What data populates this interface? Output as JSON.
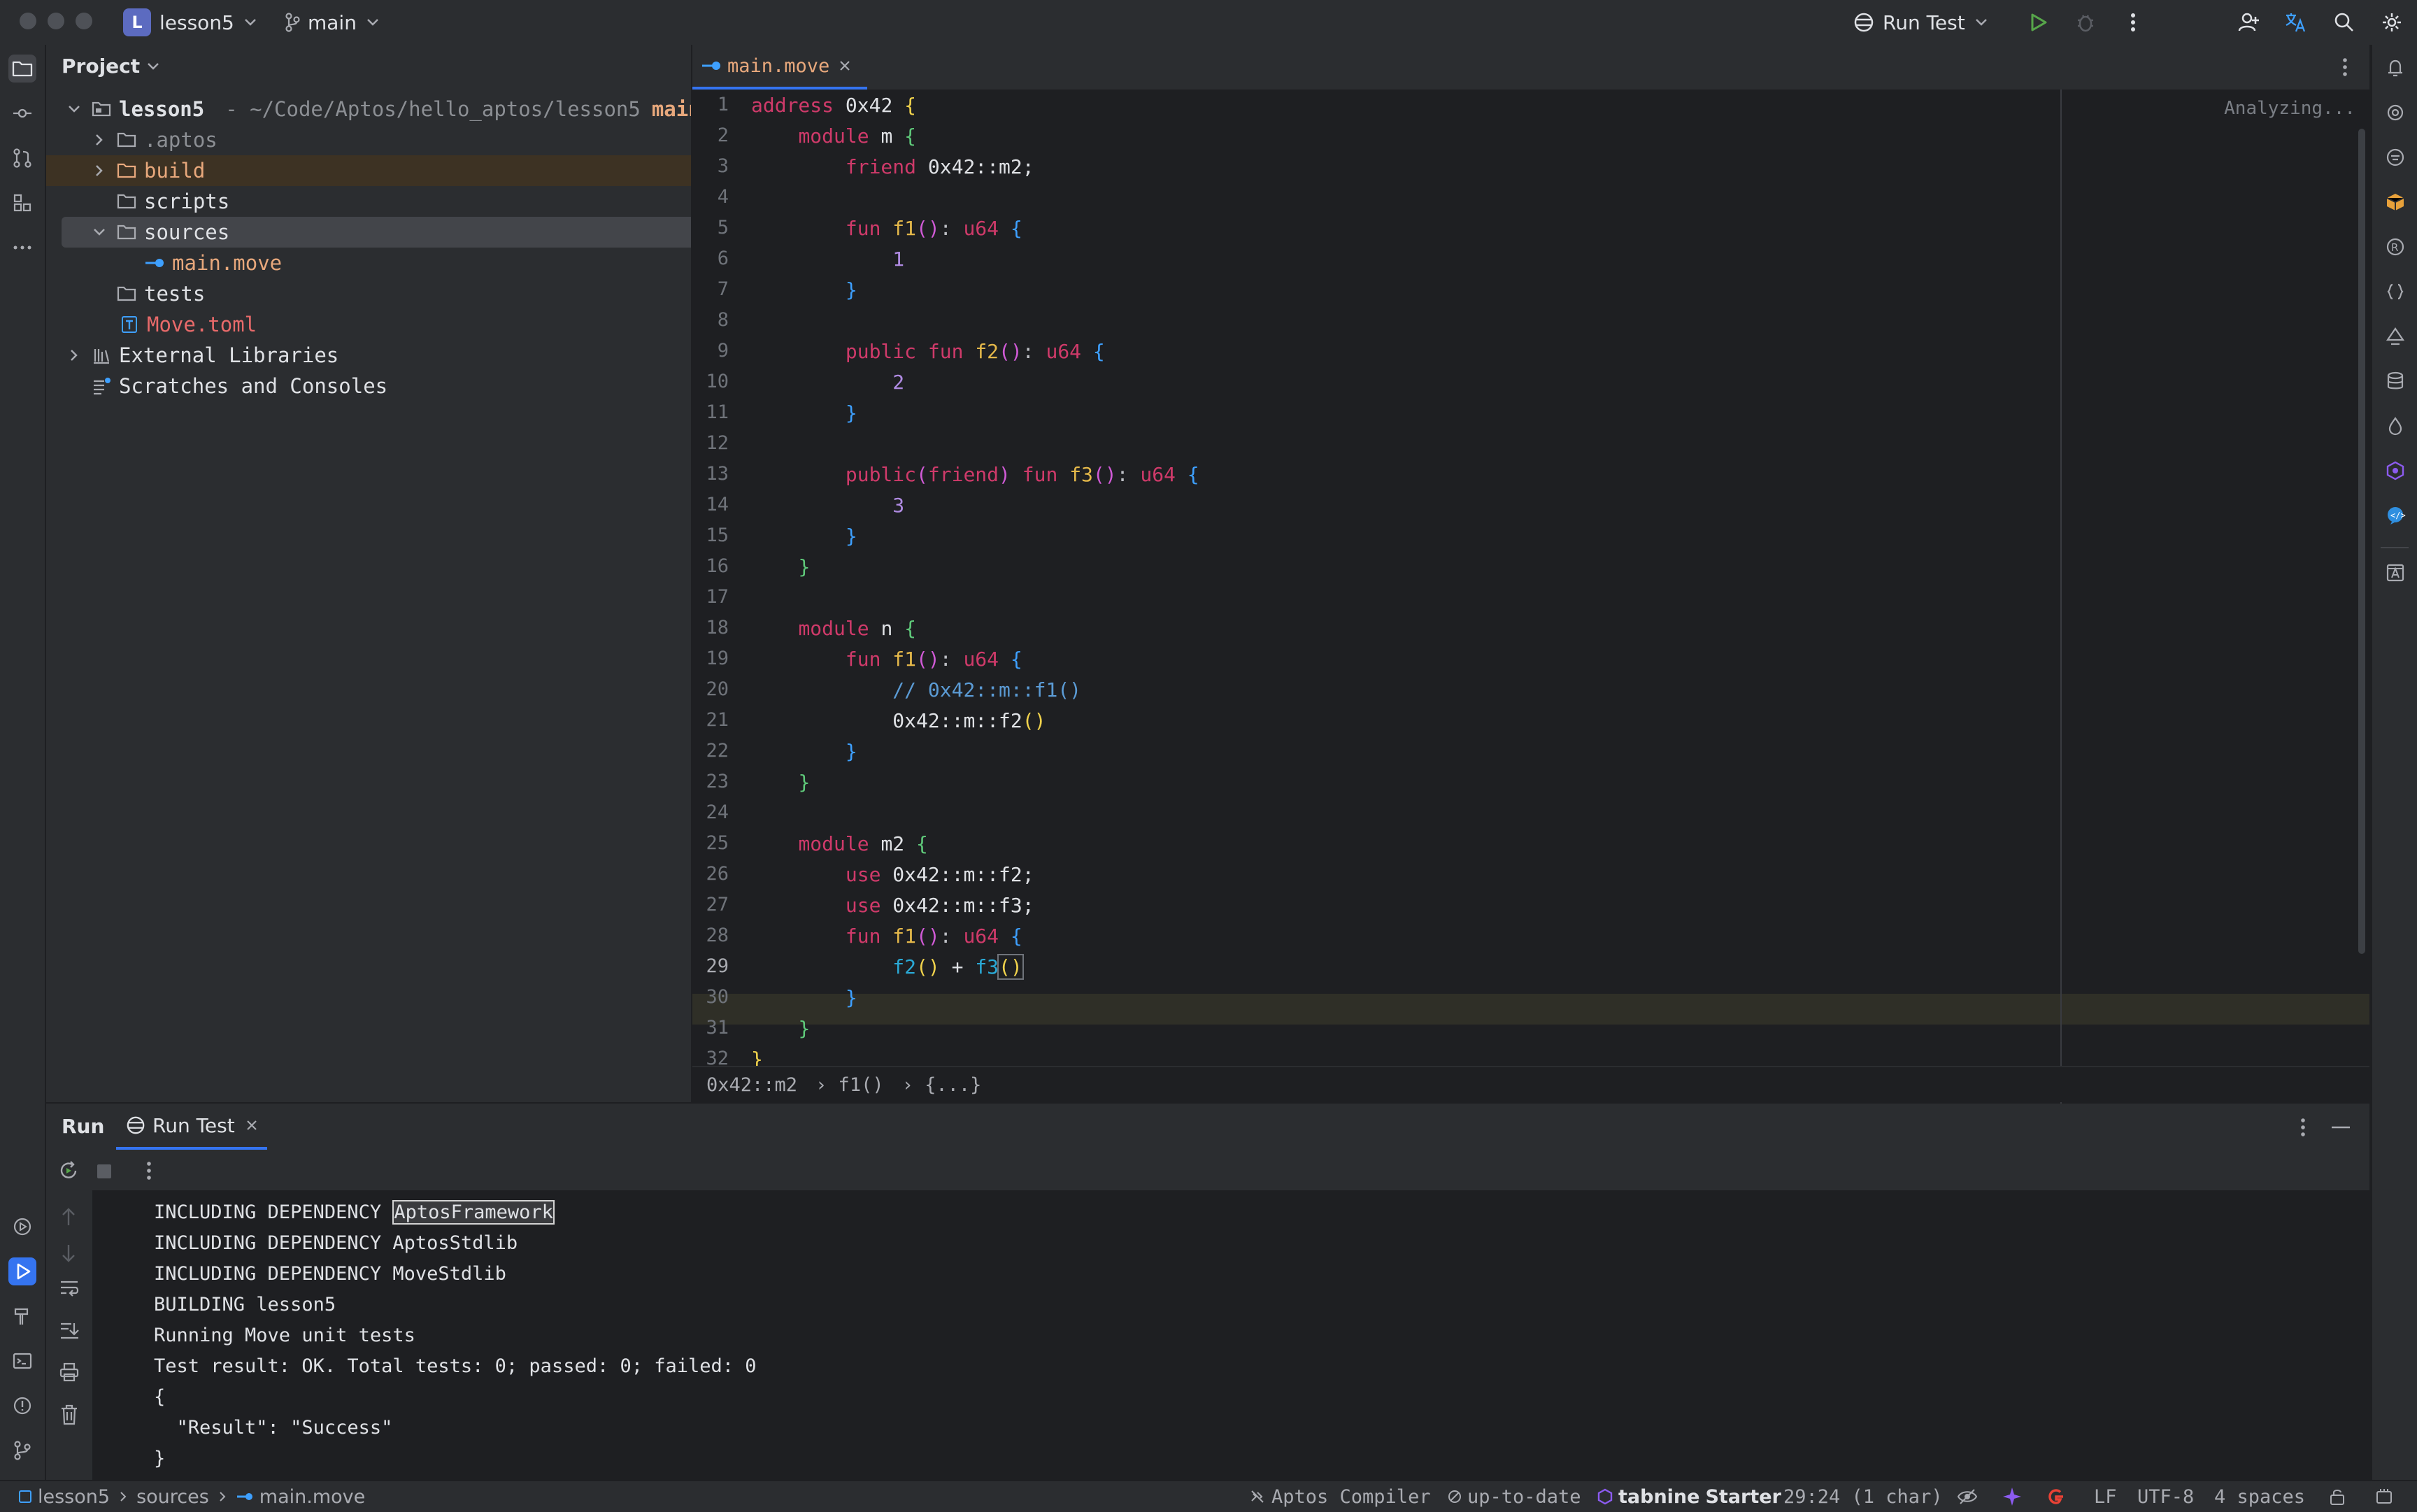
{
  "window": {
    "project_badge": "L",
    "project_name": "lesson5",
    "branch": "main",
    "run_config": "Run Test"
  },
  "project_panel": {
    "title": "Project",
    "root": {
      "name": "lesson5",
      "path": "- ~/Code/Aptos/hello_aptos/lesson5",
      "branch_tag": "main"
    },
    "items": [
      {
        "label": ".aptos"
      },
      {
        "label": "build"
      },
      {
        "label": "scripts"
      },
      {
        "label": "sources"
      },
      {
        "label": "main.move"
      },
      {
        "label": "tests"
      },
      {
        "label": "Move.toml"
      },
      {
        "label": "External Libraries"
      },
      {
        "label": "Scratches and Consoles"
      }
    ]
  },
  "editor": {
    "tab_label": "main.move",
    "status": "Analyzing...",
    "current_line": 29,
    "line_numbers": [
      "1",
      "2",
      "3",
      "4",
      "5",
      "6",
      "7",
      "8",
      "9",
      "10",
      "11",
      "12",
      "13",
      "14",
      "15",
      "16",
      "17",
      "18",
      "19",
      "20",
      "21",
      "22",
      "23",
      "24",
      "25",
      "26",
      "27",
      "28",
      "29",
      "30",
      "31",
      "32"
    ],
    "code_text": {
      "l1_kw": "address",
      "l1_addr": "0x42",
      "l2_kw": "module",
      "l2_name": "m",
      "l3_kw": "friend",
      "l3_rest": "0x42::m2;",
      "fun": "fun",
      "public": "public",
      "u64": "u64",
      "friend": "friend",
      "f1": "f1",
      "f2": "f2",
      "f3": "f3",
      "n1": "1",
      "n2": "2",
      "n3": "3",
      "mod_n": "n",
      "mod_m2": "m2",
      "comment": "// 0x42::m::f1()",
      "call_f2": "0x42::m::f2",
      "use": "use",
      "use_f2": "0x42::m::f2;",
      "use_f3": "0x42::m::f3;",
      "plus": "+"
    },
    "breadcrumbs": [
      "0x42::m2",
      "› f1()",
      "› {...}"
    ]
  },
  "run_panel": {
    "run_label": "Run",
    "tab_label": "Run Test",
    "console_lines": [
      "INCLUDING DEPENDENCY ",
      "INCLUDING DEPENDENCY AptosStdlib",
      "INCLUDING DEPENDENCY MoveStdlib",
      "BUILDING lesson5",
      "Running Move unit tests",
      "Test result: OK. Total tests: 0; passed: 0; failed: 0",
      "{",
      "  \"Result\": \"Success\"",
      "}"
    ],
    "selected_token": "AptosFramework"
  },
  "statusbar": {
    "path": [
      "lesson5",
      "sources",
      "main.move"
    ],
    "compiler": "Aptos Compiler",
    "vcs": "up-to-date",
    "tabnine_brand": "tabnine",
    "tabnine_plan": "Starter",
    "position": "29:24 (1 char)",
    "line_sep": "LF",
    "encoding": "UTF-8",
    "indent": "4 spaces"
  }
}
